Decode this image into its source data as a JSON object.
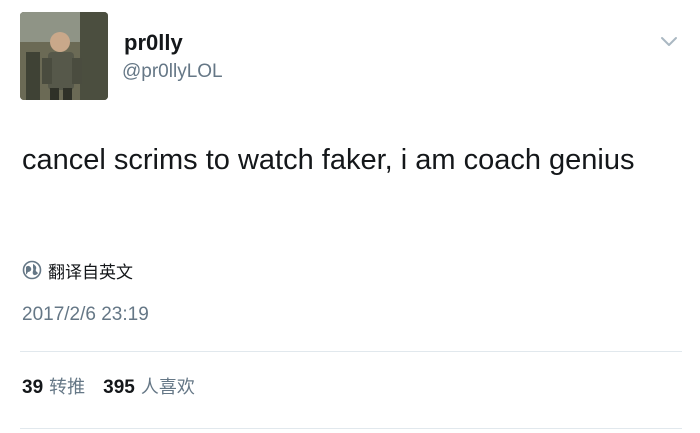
{
  "user": {
    "display_name": "pr0lly",
    "handle": "@pr0llyLOL",
    "avatar_icon": "profile-photo"
  },
  "tweet": {
    "text": "cancel scrims to watch faker, i am coach genius",
    "translate_label": "翻译自英文",
    "timestamp": "2017/2/6 23:19"
  },
  "stats": {
    "retweets_count": "39",
    "retweets_label": "转推",
    "likes_count": "395",
    "likes_label": "人喜欢"
  },
  "colors": {
    "primary_text": "#14171a",
    "secondary_text": "#657786",
    "divider": "#e1e8ed"
  },
  "icons": {
    "menu": "chevron-down-icon",
    "translate": "globe-icon"
  }
}
